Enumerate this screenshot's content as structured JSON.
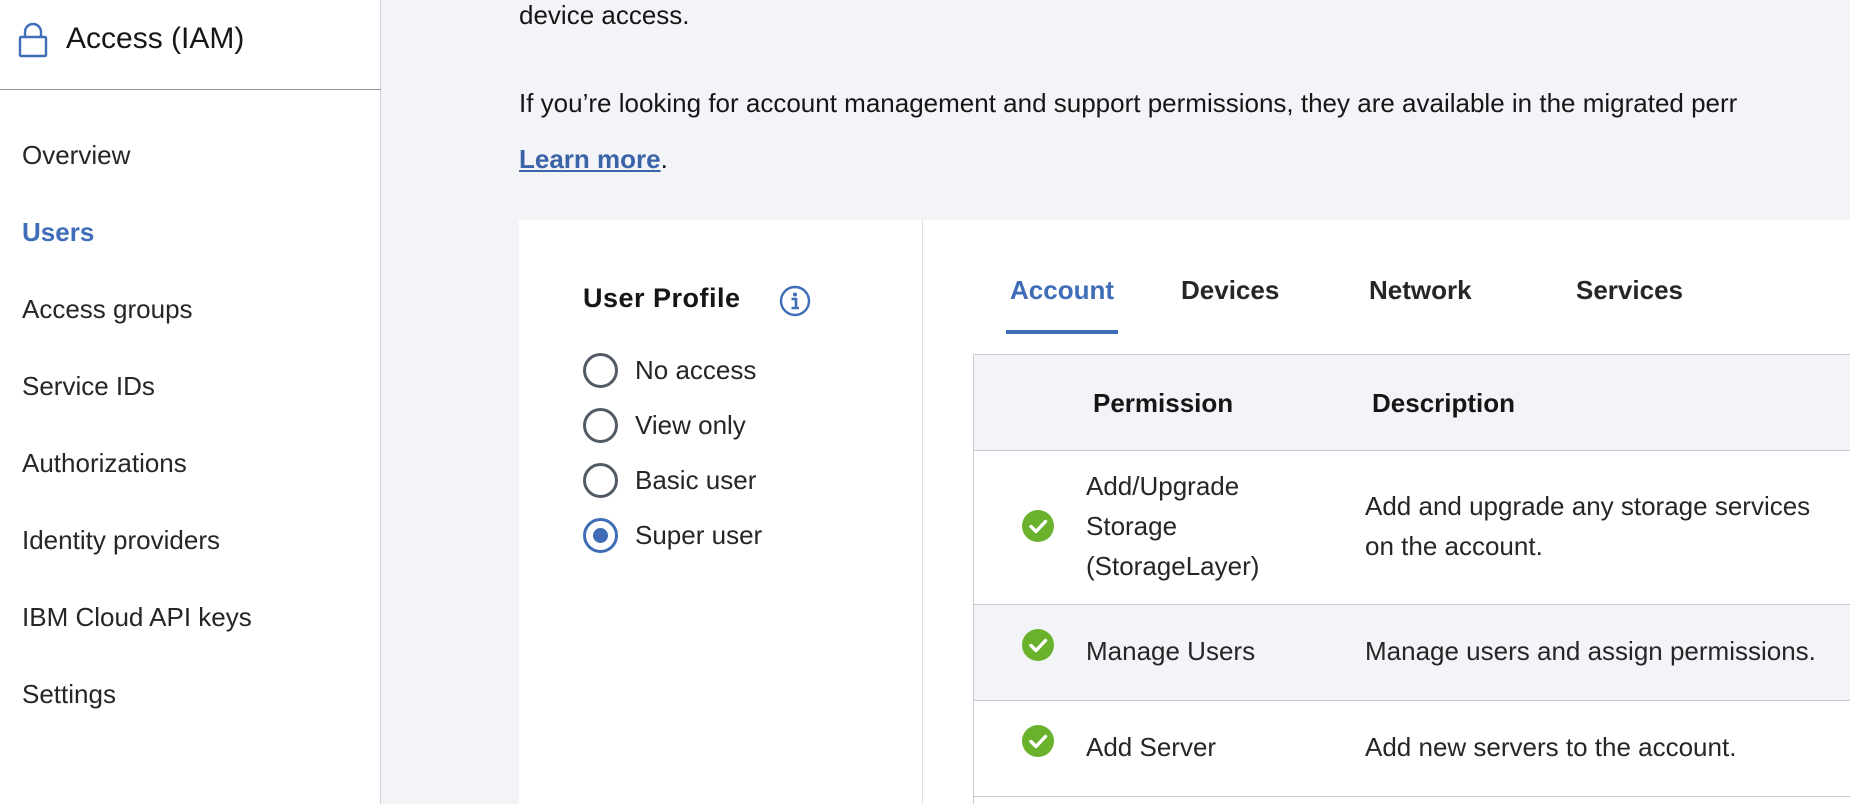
{
  "sidebar": {
    "title": "Access (IAM)",
    "icon": "lock-icon",
    "items": [
      {
        "label": "Overview",
        "active": false
      },
      {
        "label": "Users",
        "active": true
      },
      {
        "label": "Access groups",
        "active": false
      },
      {
        "label": "Service IDs",
        "active": false
      },
      {
        "label": "Authorizations",
        "active": false
      },
      {
        "label": "Identity providers",
        "active": false
      },
      {
        "label": "IBM Cloud API keys",
        "active": false
      },
      {
        "label": "Settings",
        "active": false
      }
    ]
  },
  "main": {
    "intro_line1": "device access.",
    "intro_line2": "If you’re looking for account management and support permissions, they are available in the migrated perr",
    "learn_more": "Learn more",
    "learn_more_suffix": "."
  },
  "profile": {
    "title": "User Profile",
    "info_icon": "info-icon",
    "options": [
      {
        "label": "No access",
        "checked": false
      },
      {
        "label": "View only",
        "checked": false
      },
      {
        "label": "Basic user",
        "checked": false
      },
      {
        "label": "Super user",
        "checked": true
      }
    ]
  },
  "tabs": [
    {
      "label": "Account",
      "active": true
    },
    {
      "label": "Devices",
      "active": false
    },
    {
      "label": "Network",
      "active": false
    },
    {
      "label": "Services",
      "active": false
    }
  ],
  "table": {
    "headers": {
      "permission": "Permission",
      "description": "Description"
    },
    "rows": [
      {
        "permission_lines": [
          "Add/Upgrade",
          "Storage",
          "(StorageLayer)"
        ],
        "description_lines": [
          "Add and upgrade any storage services",
          "on the account."
        ],
        "checked": true
      },
      {
        "permission_lines": [
          "Manage Users"
        ],
        "description_lines": [
          "Manage users and assign permissions."
        ],
        "checked": true
      },
      {
        "permission_lines": [
          "Add Server"
        ],
        "description_lines": [
          "Add new servers to the account."
        ],
        "checked": true
      }
    ]
  },
  "colors": {
    "accent": "#3f6db7",
    "check_green": "#6ab22c",
    "background": "#f2f4f8"
  }
}
